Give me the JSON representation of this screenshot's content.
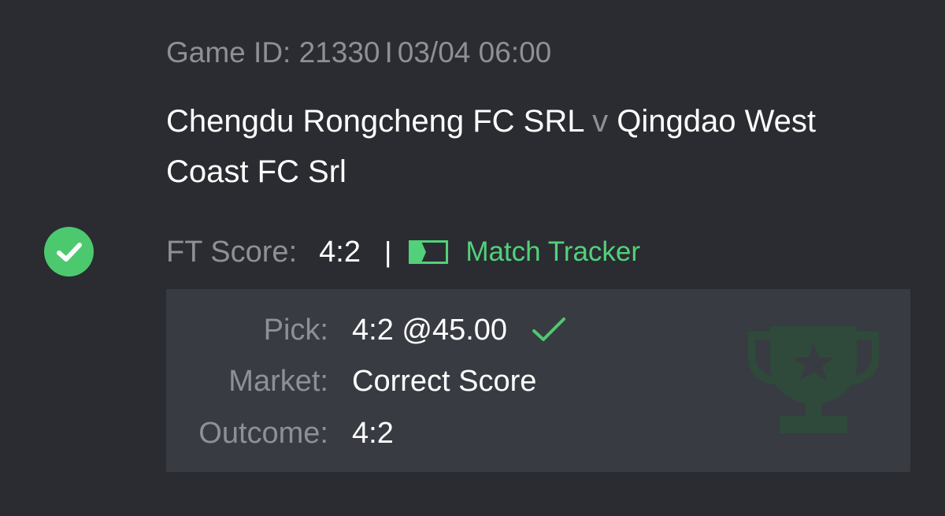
{
  "game": {
    "id_label": "Game ID: 21330",
    "separator": "I",
    "datetime": "03/04 06:00"
  },
  "match": {
    "home": "Chengdu Rongcheng FC SRL",
    "vs": "v",
    "away": "Qingdao West Coast FC Srl"
  },
  "result": {
    "status_icon": "check-circle-icon",
    "ft_label": "FT Score:",
    "ft_score": "4:2",
    "separator": "|",
    "tracker_icon": "match-tracker-icon",
    "tracker_label": "Match Tracker"
  },
  "bet": {
    "pick_label": "Pick:",
    "pick_value": "4:2 @45.00",
    "pick_status_icon": "check-icon",
    "market_label": "Market:",
    "market_value": "Correct Score",
    "outcome_label": "Outcome:",
    "outcome_value": "4:2",
    "decoration_icon": "trophy-icon"
  },
  "colors": {
    "background": "#2a2c31",
    "panel": "#383b42",
    "accent_green": "#4cc96f",
    "muted_text": "#8e9097",
    "text": "#ffffff",
    "trophy": "#2f4a3a"
  }
}
